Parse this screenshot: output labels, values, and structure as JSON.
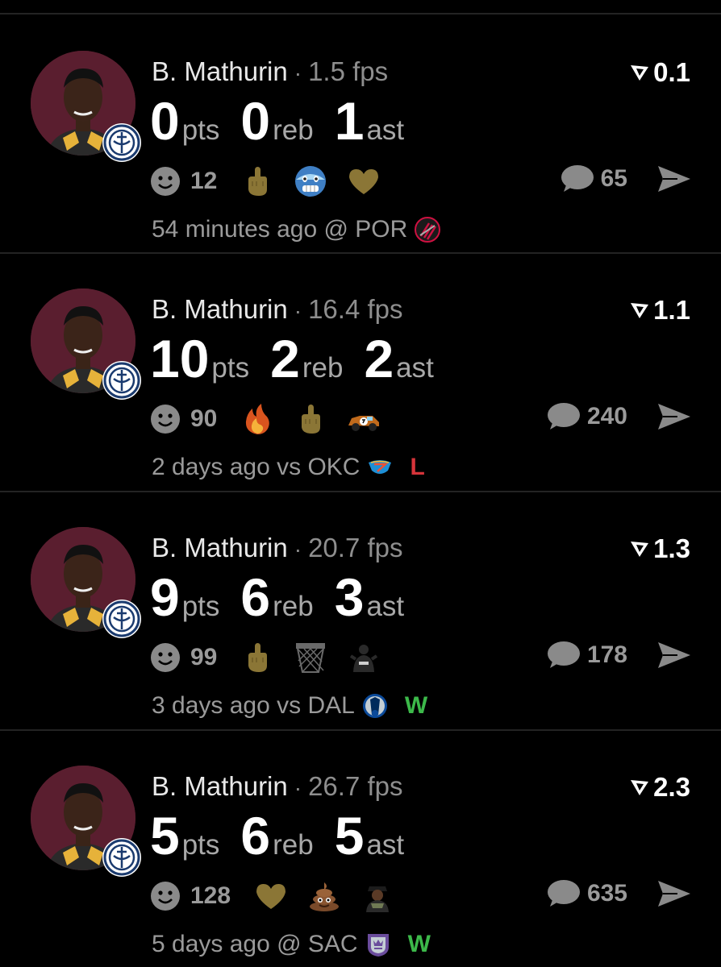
{
  "colors": {
    "background": "#000000",
    "avatar_bg": "#5a1e2f",
    "muted_text": "#9a9a9a",
    "loss": "#d6343a",
    "win": "#3cb94a",
    "gold_emoji": "#8b7636"
  },
  "posts": [
    {
      "player": "B. Mathurin",
      "fps": "1.5 fps",
      "vote": "0.1",
      "stats": [
        {
          "value": "0",
          "unit": "pts"
        },
        {
          "value": "0",
          "unit": "reb"
        },
        {
          "value": "1",
          "unit": "ast"
        }
      ],
      "reaction_count": "12",
      "emojis": [
        "middle-finger-icon",
        "cold-face-icon",
        "heart-icon"
      ],
      "comment_count": "65",
      "time": "54 minutes ago @ POR",
      "opponent_icon": "blazers-logo-icon",
      "result": ""
    },
    {
      "player": "B. Mathurin",
      "fps": "16.4 fps",
      "vote": "1.1",
      "stats": [
        {
          "value": "10",
          "unit": "pts"
        },
        {
          "value": "2",
          "unit": "reb"
        },
        {
          "value": "2",
          "unit": "ast"
        }
      ],
      "reaction_count": "90",
      "emojis": [
        "fire-icon",
        "middle-finger-icon",
        "race-car-icon"
      ],
      "comment_count": "240",
      "time": "2 days ago vs OKC",
      "opponent_icon": "thunder-logo-icon",
      "result": "L"
    },
    {
      "player": "B. Mathurin",
      "fps": "20.7 fps",
      "vote": "1.3",
      "stats": [
        {
          "value": "9",
          "unit": "pts"
        },
        {
          "value": "6",
          "unit": "reb"
        },
        {
          "value": "3",
          "unit": "ast"
        }
      ],
      "reaction_count": "99",
      "emojis": [
        "middle-finger-icon",
        "basketball-hoop-icon",
        "player-sticker-icon"
      ],
      "comment_count": "178",
      "time": "3 days ago vs DAL",
      "opponent_icon": "mavericks-logo-icon",
      "result": "W"
    },
    {
      "player": "B. Mathurin",
      "fps": "26.7 fps",
      "vote": "2.3",
      "stats": [
        {
          "value": "5",
          "unit": "pts"
        },
        {
          "value": "6",
          "unit": "reb"
        },
        {
          "value": "5",
          "unit": "ast"
        }
      ],
      "reaction_count": "128",
      "emojis": [
        "heart-icon",
        "poop-icon",
        "person-sticker-icon"
      ],
      "comment_count": "635",
      "time": "5 days ago @ SAC",
      "opponent_icon": "kings-logo-icon",
      "result": "W"
    }
  ]
}
